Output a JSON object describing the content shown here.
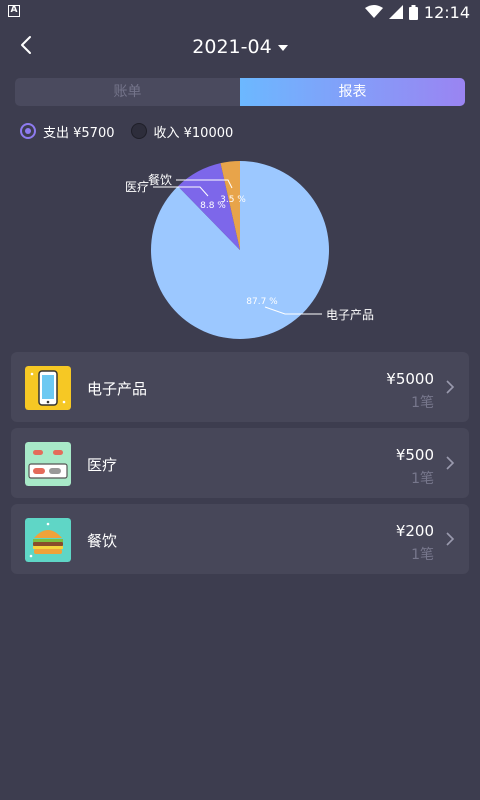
{
  "status": {
    "time": "12:14",
    "app_icon": "A"
  },
  "header": {
    "title": "2021-04"
  },
  "tabs": [
    {
      "label": "账单"
    },
    {
      "label": "报表"
    }
  ],
  "filters": {
    "expense": {
      "label": "支出 ¥5700",
      "selected": true
    },
    "income": {
      "label": "收入 ¥10000",
      "selected": false
    }
  },
  "colors": {
    "electronics": "#9cc8ff",
    "medical": "#7d67ea",
    "food": "#e8a44a"
  },
  "chart_data": {
    "type": "pie",
    "slices": [
      {
        "name": "电子产品",
        "value": 5000,
        "label": "87.7 %"
      },
      {
        "name": "医疗",
        "value": 500,
        "label": "8.8 %"
      },
      {
        "name": "餐饮",
        "value": 200,
        "label": "3.5 %"
      }
    ]
  },
  "items": [
    {
      "name": "电子产品",
      "amount": "¥5000",
      "count": "1笔",
      "icon": "phone-icon"
    },
    {
      "name": "医疗",
      "amount": "¥500",
      "count": "1笔",
      "icon": "pills-icon"
    },
    {
      "name": "餐饮",
      "amount": "¥200",
      "count": "1笔",
      "icon": "burger-icon"
    }
  ]
}
